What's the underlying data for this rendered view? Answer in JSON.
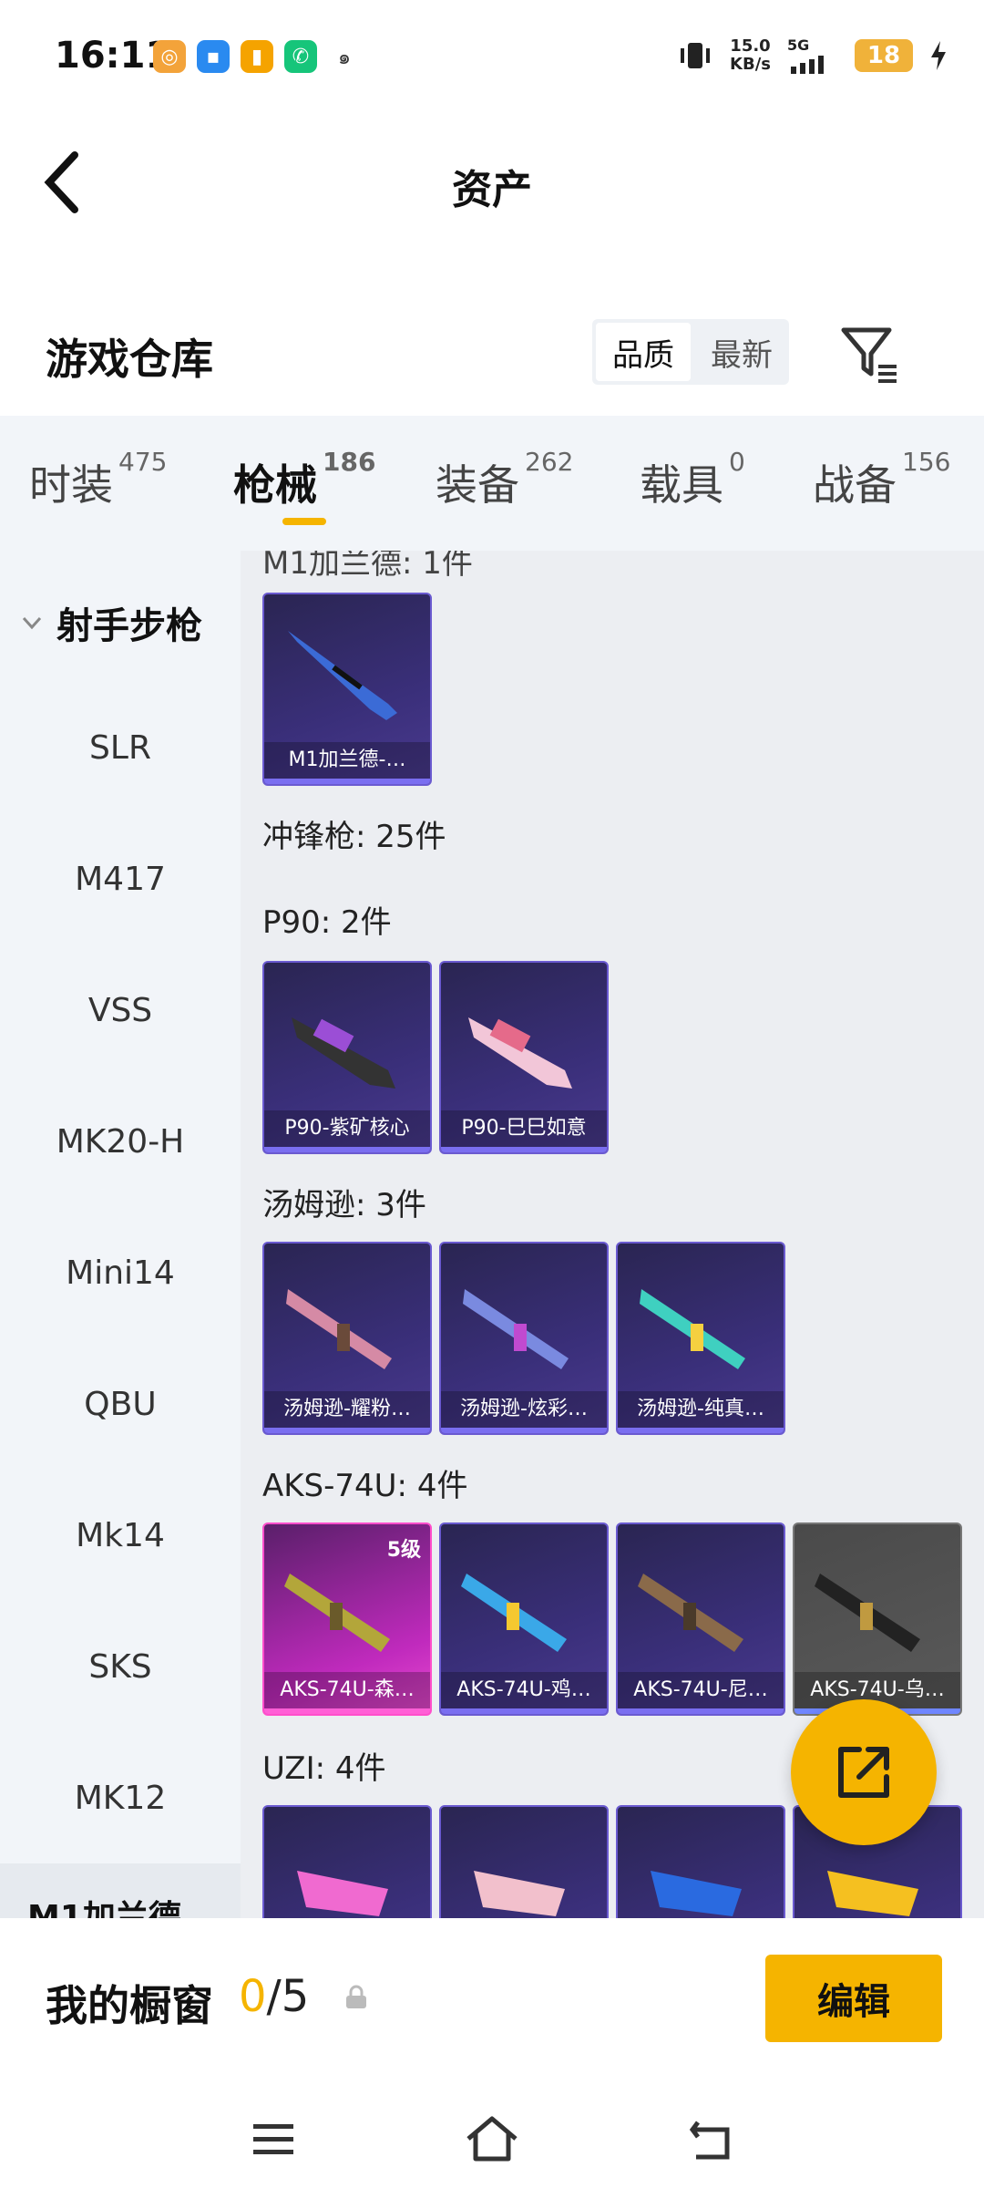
{
  "status_bar": {
    "time": "16:11",
    "net_speed_value": "15.0",
    "net_speed_unit": "KB/s",
    "network": "5G",
    "battery": "18",
    "app_icons": [
      "weibo-icon",
      "cloud-icon",
      "note-icon",
      "chat-icon",
      "netease-icon"
    ]
  },
  "header": {
    "title": "资产"
  },
  "warehouse": {
    "title": "游戏仓库",
    "sort_options": [
      "品质",
      "最新"
    ],
    "selected_sort": "品质"
  },
  "tabs": [
    {
      "label": "时装",
      "count": "475"
    },
    {
      "label": "枪械",
      "count": "186",
      "active": true
    },
    {
      "label": "装备",
      "count": "262"
    },
    {
      "label": "载具",
      "count": "0"
    },
    {
      "label": "战备",
      "count": "156"
    }
  ],
  "sidebar": {
    "section": "射手步枪",
    "items": [
      "SLR",
      "M417",
      "VSS",
      "MK20-H",
      "Mini14",
      "QBU",
      "Mk14",
      "SKS",
      "MK12"
    ],
    "cut_off_label": "M1加兰德"
  },
  "content": {
    "top_cut_label": "M1加兰德: 1件",
    "m1_items": [
      "M1加兰德-…"
    ],
    "smg_header": "冲锋枪: 25件",
    "groups": [
      {
        "label": "P90: 2件",
        "items": [
          "P90-紫矿核心",
          "P90-巳巳如意"
        ]
      },
      {
        "label": "汤姆逊: 3件",
        "items": [
          "汤姆逊-耀粉…",
          "汤姆逊-炫彩…",
          "汤姆逊-纯真…"
        ]
      },
      {
        "label": "AKS-74U: 4件",
        "items": [
          "AKS-74U-森…",
          "AKS-74U-鸡…",
          "AKS-74U-尼…",
          "AKS-74U-乌…"
        ],
        "first_level": "5级"
      },
      {
        "label": "UZI: 4件",
        "items": [
          "",
          "",
          "",
          ""
        ]
      }
    ]
  },
  "showcase": {
    "title": "我的橱窗",
    "current": "0",
    "total": "/5",
    "edit_label": "编辑"
  },
  "colors": {
    "accent": "#f5b400",
    "tab_bg": "#f2f5f9",
    "content_bg": "#eceef2",
    "card_purple": "#3a2f7a",
    "card_pink": "#c02abd"
  }
}
